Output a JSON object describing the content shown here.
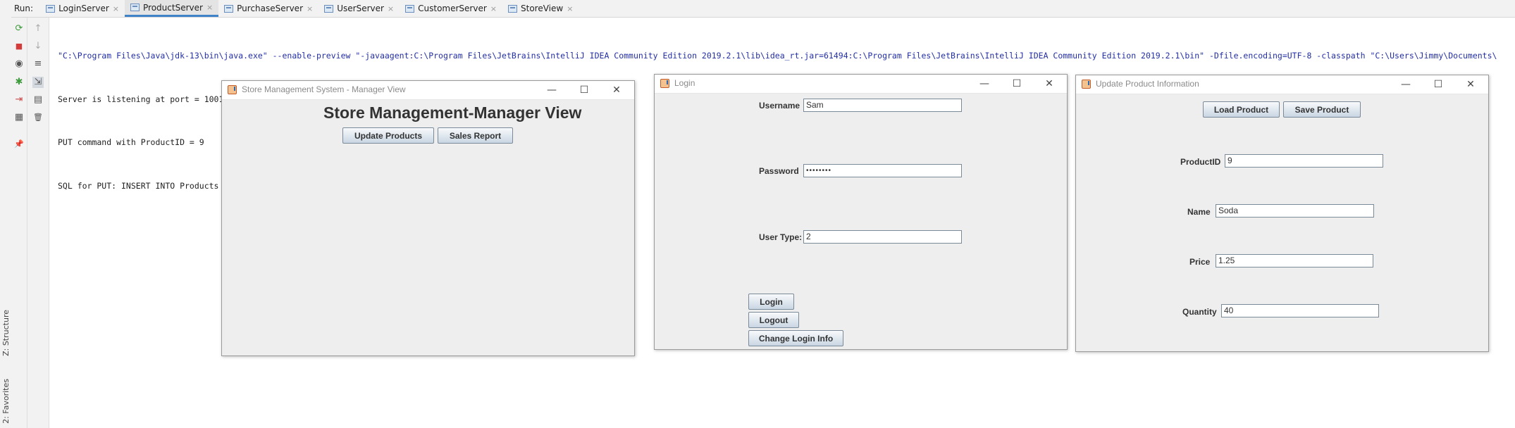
{
  "run_bar": {
    "label": "Run:",
    "tabs": [
      {
        "label": "LoginServer",
        "close": "×"
      },
      {
        "label": "ProductServer",
        "close": "×"
      },
      {
        "label": "PurchaseServer",
        "close": "×"
      },
      {
        "label": "UserServer",
        "close": "×"
      },
      {
        "label": "CustomerServer",
        "close": "×"
      },
      {
        "label": "StoreView",
        "close": "×"
      }
    ]
  },
  "toolbar": {
    "rerun": "⟳",
    "stop": "■",
    "up": "↑",
    "down": "↓",
    "camera": "◉",
    "soft_wrap": "≡",
    "debug": "✱",
    "scroll_end": "⇲",
    "exit": "⇥",
    "print": "▤",
    "layout": "▦",
    "trash": "🗑",
    "pin": "📌"
  },
  "left_strip": {
    "structure": "Z: Structure",
    "favorites": "2: Favorites"
  },
  "console": {
    "lines": [
      "\"C:\\Program Files\\Java\\jdk-13\\bin\\java.exe\" --enable-preview \"-javaagent:C:\\Program Files\\JetBrains\\IntelliJ IDEA Community Edition 2019.2.1\\lib\\idea_rt.jar=61494:C:\\Program Files\\JetBrains\\IntelliJ IDEA Community Edition 2019.2.1\\bin\" -Dfile.encoding=UTF-8 -classpath \"C:\\Users\\Jimmy\\Documents\\",
      "Server is listening at port = 1001",
      "PUT command with ProductID = 9",
      "SQL for PUT: INSERT INTO Products VALUES (9,\"Soda\",40.0,1.25)"
    ]
  },
  "window_controls": {
    "minimize": "—",
    "maximize": "☐",
    "close": "✕"
  },
  "manager_window": {
    "title": "Store Management System - Manager View",
    "heading": "Store Management-Manager View",
    "update_products": "Update Products",
    "sales_report": "Sales Report"
  },
  "login_window": {
    "title": "Login",
    "username_label": "Username",
    "username_value": "Sam",
    "password_label": "Password",
    "password_value": "••••••••",
    "user_type_label": "User Type:",
    "user_type_value": "2",
    "login_button": "Login",
    "logout_button": "Logout",
    "change_login_button": "Change Login Info"
  },
  "update_window": {
    "title": "Update Product Information",
    "load_button": "Load Product",
    "save_button": "Save Product",
    "product_id_label": "ProductID",
    "product_id_value": "9",
    "name_label": "Name",
    "name_value": "Soda",
    "price_label": "Price",
    "price_value": "1.25",
    "quantity_label": "Quantity",
    "quantity_value": "40"
  }
}
